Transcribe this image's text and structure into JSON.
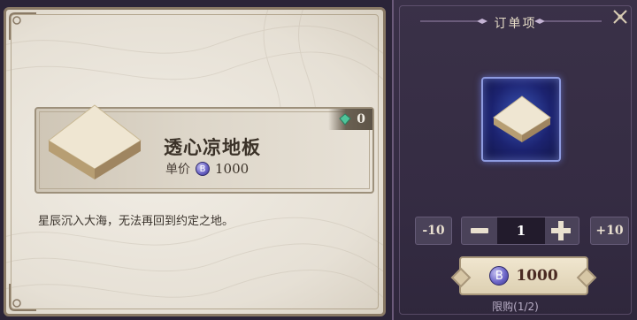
{
  "item": {
    "name": "透心凉地板",
    "price_label": "单价",
    "price": "1000",
    "owned_count": "0",
    "description": "星辰沉入大海，无法再回到约定之地。"
  },
  "order": {
    "title": "订单项",
    "minus10_label": "-10",
    "plus10_label": "+10",
    "quantity": "1",
    "total_price": "1000",
    "limit_text": "限购(1/2)"
  },
  "colors": {
    "currency_coin": "#6d66c8",
    "panel_dark": "#352c43",
    "panel_light": "#e6e0d5"
  },
  "icons": {
    "currency": "B",
    "owned": "green-gem-icon",
    "close": "close-icon"
  }
}
